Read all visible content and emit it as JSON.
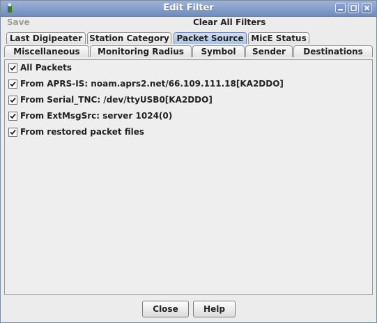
{
  "window": {
    "title": "Edit Filter"
  },
  "menu": {
    "save": "Save",
    "clear_all": "Clear All Filters"
  },
  "tabs": {
    "last_digipeater": "Last Digipeater",
    "station_category": "Station Category",
    "packet_source": "Packet Source",
    "mice_status": "MicE Status",
    "miscellaneous": "Miscellaneous",
    "monitoring_radius": "Monitoring Radius",
    "symbol": "Symbol",
    "sender": "Sender",
    "destinations": "Destinations",
    "selected": "Packet Source"
  },
  "sources": [
    {
      "label": "All Packets",
      "checked": true
    },
    {
      "label": "From APRS-IS: noam.aprs2.net/66.109.111.18[KA2DDO]",
      "checked": true
    },
    {
      "label": "From Serial_TNC: /dev/ttyUSB0[KA2DDO]",
      "checked": true
    },
    {
      "label": "From ExtMsgSrc: server 1024(0)",
      "checked": true
    },
    {
      "label": "From restored packet files",
      "checked": true
    }
  ],
  "buttons": {
    "close": "Close",
    "help": "Help"
  },
  "colors": {
    "titlebar": "#7f9acb",
    "selected_tab": "#b9cfec",
    "panel": "#eeeeee"
  }
}
